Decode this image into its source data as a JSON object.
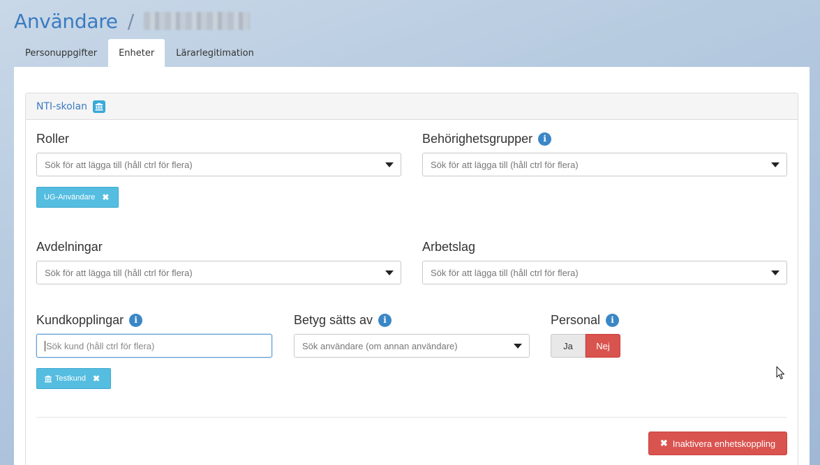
{
  "header": {
    "title": "Användare",
    "separator": "/"
  },
  "tabs": [
    {
      "label": "Personuppgifter",
      "active": false
    },
    {
      "label": "Enheter",
      "active": true
    },
    {
      "label": "Lärarlegitimation",
      "active": false
    }
  ],
  "panel": {
    "unit_name": "NTI-skolan",
    "roller": {
      "label": "Roller",
      "placeholder": "Sök för att lägga till (håll ctrl för flera)",
      "tags": [
        "UG-Användare"
      ]
    },
    "behorighetsgrupper": {
      "label": "Behörighetsgrupper",
      "placeholder": "Sök för att lägga till (håll ctrl för flera)"
    },
    "avdelningar": {
      "label": "Avdelningar",
      "placeholder": "Sök för att lägga till (håll ctrl för flera)"
    },
    "arbetslag": {
      "label": "Arbetslag",
      "placeholder": "Sök för att lägga till (håll ctrl för flera)"
    },
    "kundkopplingar": {
      "label": "Kundkopplingar",
      "placeholder": "Sök kund (håll ctrl för flera)",
      "tags": [
        "Testkund"
      ]
    },
    "betyg": {
      "label": "Betyg sätts av",
      "placeholder": "Sök användare (om annan användare)"
    },
    "personal": {
      "label": "Personal",
      "options": [
        "Ja",
        "Nej"
      ],
      "selected": "Nej"
    },
    "deactivate_label": "Inaktivera enhetskoppling"
  },
  "colors": {
    "accent": "#3a7bbf",
    "tag": "#55bde0",
    "danger": "#d9534f"
  }
}
